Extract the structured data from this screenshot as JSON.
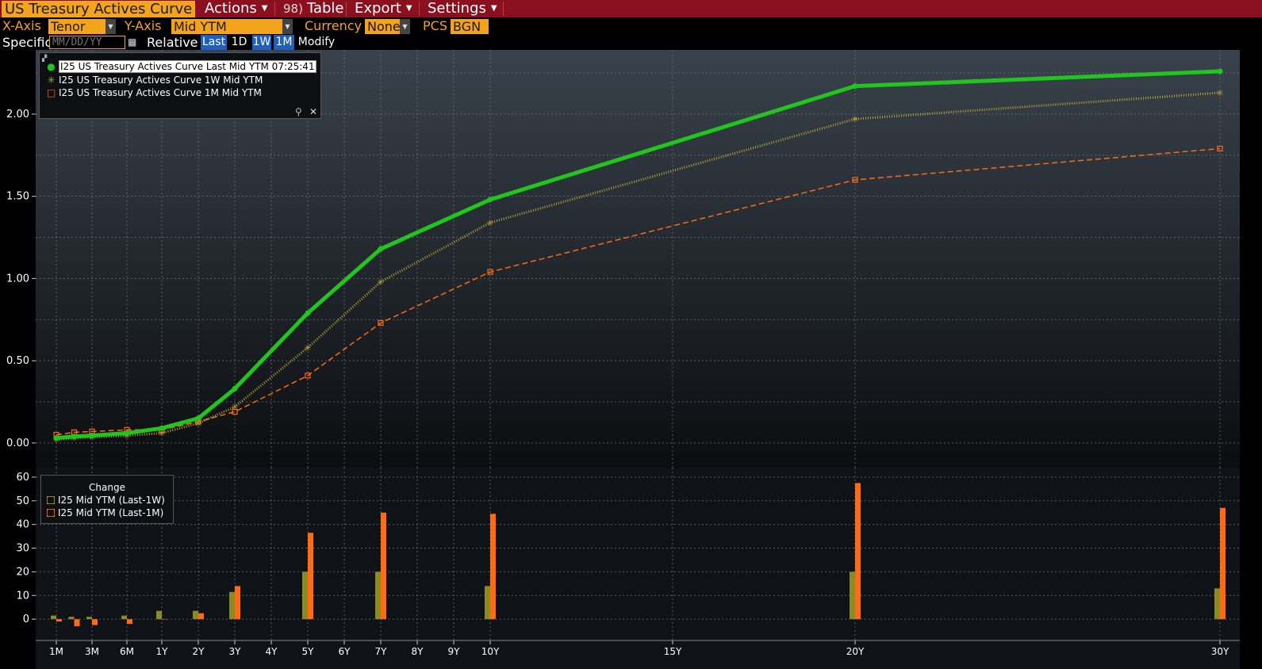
{
  "toolbar": {
    "title": "US Treasury Actives Curve",
    "actions_label": "Actions",
    "table_num": "98)",
    "table_label": "Table",
    "export_label": "Export",
    "settings_label": "Settings"
  },
  "controls": {
    "x_axis_label": "X-Axis",
    "x_axis_value": "Tenor",
    "y_axis_label": "Y-Axis",
    "y_axis_value": "Mid YTM",
    "currency_label": "Currency",
    "currency_value": "None",
    "pcs_label": "PCS",
    "pcs_value": "BGN",
    "specific_label": "Specific",
    "date_placeholder": "MM/DD/YY",
    "relative_label": "Relative",
    "last_label": "Last",
    "d1_label": "1D",
    "w1_label": "1W",
    "m1_label": "1M",
    "modify_label": "Modify"
  },
  "colors": {
    "last": "#22c41e",
    "one_week": "#b7a23a",
    "one_month": "#ff6a12",
    "bar_1w": "#8e8a22",
    "bar_1m": "#ff6a12",
    "grid": "#6f7a86"
  },
  "legend_main": {
    "items": [
      {
        "label": "I25 US Treasury Actives Curve Last Mid YTM 07:25:41",
        "marker": "●"
      },
      {
        "label": "I25 US Treasury Actives Curve 1W Mid YTM",
        "marker": "✳"
      },
      {
        "label": "I25 US Treasury Actives Curve 1M Mid YTM",
        "marker": "□"
      }
    ],
    "pin_icon": "pin-icon",
    "close_icon": "close-icon"
  },
  "legend_change": {
    "title": "Change",
    "items": [
      {
        "label": "I25 Mid YTM (Last-1W)"
      },
      {
        "label": "I25 Mid YTM (Last-1M)"
      }
    ]
  },
  "chart_data": [
    {
      "type": "line",
      "x": [
        "1M",
        "2M",
        "3M",
        "6M",
        "1Y",
        "2Y",
        "3Y",
        "5Y",
        "7Y",
        "10Y",
        "20Y",
        "30Y"
      ],
      "x_ticks": [
        "1M",
        "3M",
        "6M",
        "1Y",
        "2Y",
        "3Y",
        "4Y",
        "5Y",
        "6Y",
        "7Y",
        "8Y",
        "9Y",
        "10Y",
        "15Y",
        "20Y",
        "30Y"
      ],
      "ylim": [
        -0.15,
        2.39
      ],
      "y_ticks": [
        "0.00",
        "0.50",
        "1.00",
        "1.50",
        "2.00"
      ],
      "series": [
        {
          "name": "I25 US Treasury Actives Curve Last Mid YTM 07:25:41",
          "values": [
            0.03,
            0.04,
            0.045,
            0.06,
            0.09,
            0.15,
            0.33,
            0.79,
            1.18,
            1.48,
            2.17,
            2.26
          ]
        },
        {
          "name": "I25 US Treasury Actives Curve 1W Mid YTM",
          "values": [
            0.02,
            0.03,
            0.035,
            0.045,
            0.06,
            0.12,
            0.22,
            0.58,
            0.98,
            1.34,
            1.97,
            2.13
          ]
        },
        {
          "name": "I25 US Treasury Actives Curve 1M Mid YTM",
          "values": [
            0.05,
            0.065,
            0.07,
            0.08,
            0.08,
            0.13,
            0.19,
            0.41,
            0.73,
            1.04,
            1.6,
            1.79
          ]
        }
      ]
    },
    {
      "type": "bar",
      "title": "Change",
      "categories": [
        "1M",
        "2M",
        "3M",
        "6M",
        "1Y",
        "2Y",
        "3Y",
        "5Y",
        "7Y",
        "10Y",
        "20Y",
        "30Y"
      ],
      "ylim": [
        -9,
        64
      ],
      "y_ticks": [
        "0",
        "10",
        "20",
        "30",
        "40",
        "50",
        "60"
      ],
      "series": [
        {
          "name": "I25 Mid YTM (Last-1W)",
          "values": [
            1.5,
            1,
            1,
            1.5,
            3.5,
            3.5,
            11.5,
            20,
            20,
            14,
            20,
            13
          ]
        },
        {
          "name": "I25 Mid YTM (Last-1M)",
          "values": [
            -1,
            -3,
            -2.5,
            -2,
            0,
            2.5,
            14,
            36.5,
            45,
            44.5,
            57.5,
            47
          ]
        }
      ]
    }
  ]
}
